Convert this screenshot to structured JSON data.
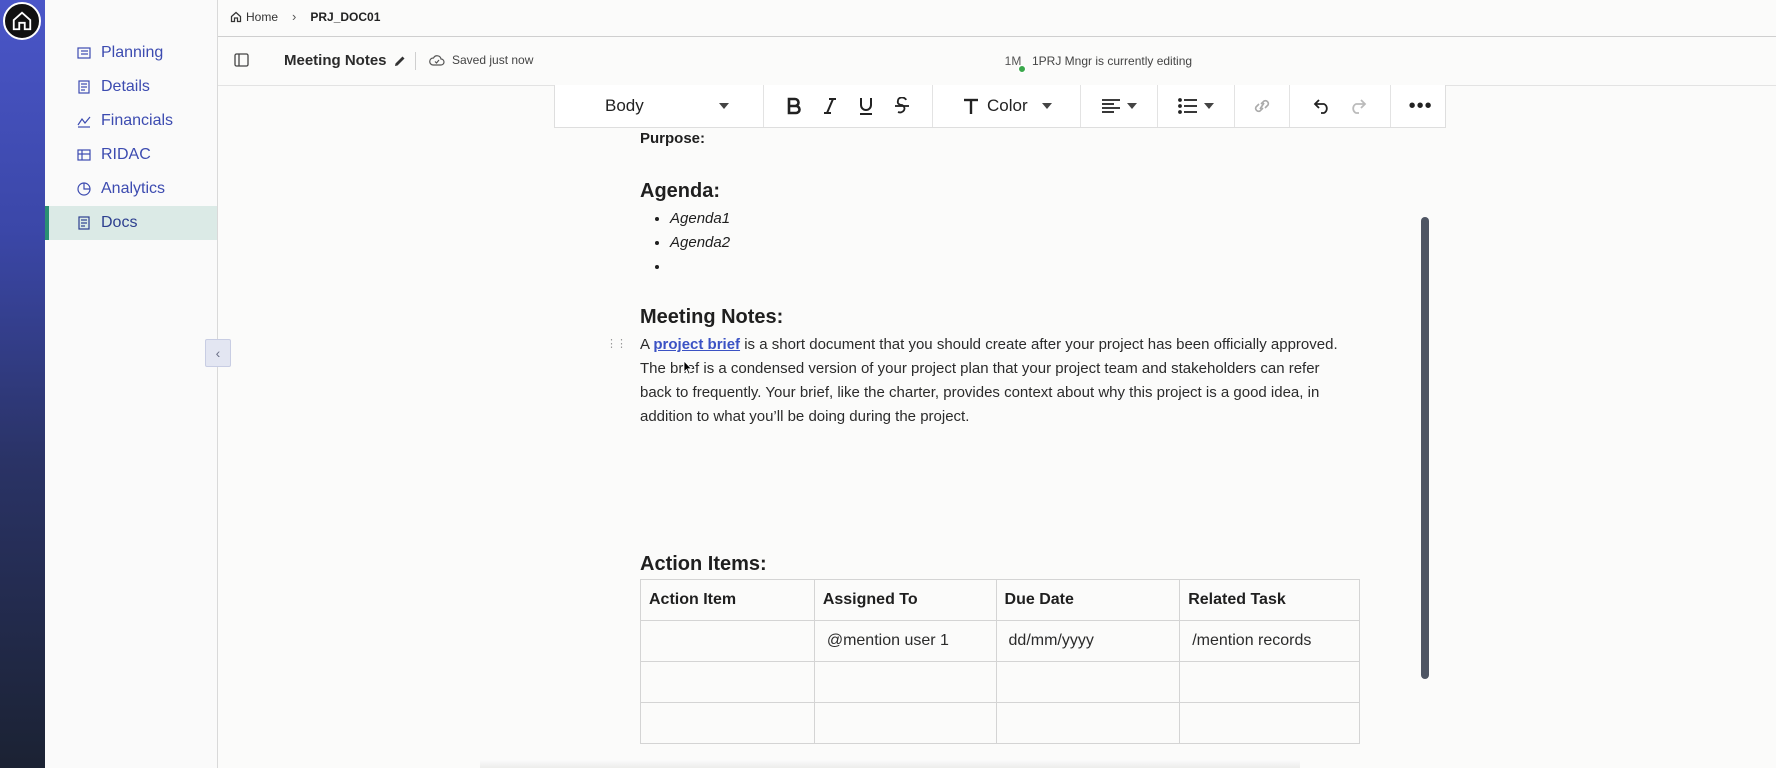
{
  "breadcrumb": {
    "home": "Home",
    "current": "PRJ_DOC01"
  },
  "sidebar": {
    "items": [
      {
        "label": "Planning",
        "icon": "planning-icon"
      },
      {
        "label": "Details",
        "icon": "details-icon"
      },
      {
        "label": "Financials",
        "icon": "financials-icon"
      },
      {
        "label": "RIDAC",
        "icon": "table-icon"
      },
      {
        "label": "Analytics",
        "icon": "analytics-icon"
      },
      {
        "label": "Docs",
        "icon": "docs-icon",
        "active": true
      }
    ]
  },
  "doc": {
    "title": "Meeting Notes",
    "saved_status": "Saved just now",
    "editor_initials": "1M",
    "editing_status": "1PRJ Mngr is currently editing"
  },
  "toolbar": {
    "text_style": "Body",
    "color_label": "Color"
  },
  "content": {
    "purpose_label": "Purpose:",
    "agenda_heading": "Agenda:",
    "agenda_items": [
      "Agenda1",
      "Agenda2",
      ""
    ],
    "notes_heading": "Meeting Notes:",
    "notes_pre": "A ",
    "notes_link": "project brief",
    "notes_post": " is a short document that you should create after your project has been officially approved. The brief is a condensed version of your project plan that your project team and stakeholders can refer back to frequently. Your brief, like the charter, provides context about why this project is a good idea, in addition to what you’ll be doing during the project.",
    "actions_heading": "Action Items:",
    "table": {
      "headers": [
        "Action Item",
        "Assigned To",
        "Due Date",
        "Related Task"
      ],
      "rows": [
        [
          "",
          "@mention user 1",
          "dd/mm/yyyy",
          "/mention records"
        ],
        [
          "",
          "",
          "",
          ""
        ],
        [
          "",
          "",
          "",
          ""
        ]
      ]
    }
  },
  "colors": {
    "accent": "#3c4bb0",
    "active_bg": "#dbeae6",
    "active_bar": "#2a8f73",
    "presence": "#3aa84b"
  }
}
